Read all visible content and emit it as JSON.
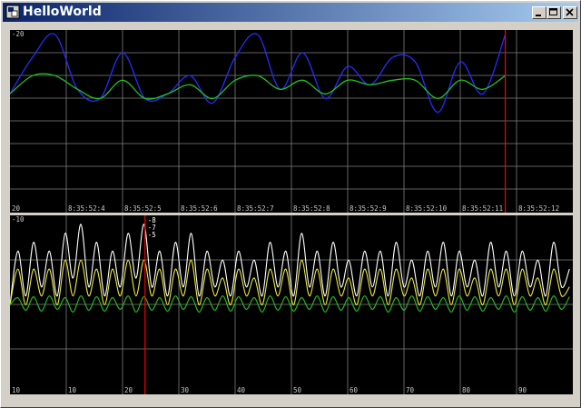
{
  "window": {
    "title": "HelloWorld"
  },
  "title_bar": {
    "minimize_icon": "minimize-icon",
    "maximize_icon": "maximize-icon",
    "close_icon": "close-icon"
  },
  "colors": {
    "background": "#000000",
    "grid": "#7f7f7f",
    "cursor": "#ff0000"
  },
  "chart_data": [
    {
      "type": "line",
      "y_top_label": "-20",
      "y_bottom_label": "20",
      "x_tick_labels": [
        "8:35:52:4",
        "8:35:52:5",
        "8:35:52:6",
        "8:35:52:7",
        "8:35:52:8",
        "8:35:52:9",
        "8:35:52:10",
        "8:35:52:11",
        "8:35:52:12"
      ],
      "ylim": [
        -20,
        20
      ],
      "cursor_x": 8.8,
      "series": [
        {
          "color": "#2a2aff",
          "x": [
            0,
            0.4,
            0.8,
            1.2,
            1.6,
            2,
            2.4,
            2.8,
            3.2,
            3.6,
            4,
            4.4,
            4.8,
            5.2,
            5.6,
            6,
            6.4,
            6.8,
            7.2,
            7.6,
            8,
            8.4,
            8.8
          ],
          "values": [
            -6,
            -14,
            -19,
            -7,
            -5,
            -15,
            -5,
            -6,
            -10,
            -4,
            -14,
            -19,
            -7,
            -15,
            -5,
            -12,
            -8,
            -14,
            -13,
            -2,
            -13,
            -6,
            -19
          ]
        },
        {
          "color": "#22c022",
          "x": [
            0,
            0.4,
            0.8,
            1.2,
            1.6,
            2,
            2.4,
            2.8,
            3.2,
            3.6,
            4,
            4.4,
            4.8,
            5.2,
            5.6,
            6,
            6.4,
            6.8,
            7.2,
            7.6,
            8,
            8.4,
            8.8
          ],
          "values": [
            -6,
            -10,
            -10,
            -7,
            -5,
            -9,
            -5,
            -6,
            -8,
            -5,
            -9,
            -10,
            -7,
            -9,
            -6,
            -9,
            -8,
            -9,
            -9,
            -5,
            -9,
            -7,
            -10
          ]
        }
      ]
    },
    {
      "type": "line",
      "y_top_label": "-10",
      "x_tick_labels": [
        "10",
        "10",
        "20",
        "30",
        "40",
        "50",
        "60",
        "70",
        "80",
        "90"
      ],
      "xlim": [
        0,
        100
      ],
      "ylim": [
        -10,
        10
      ],
      "cursor_x": 24,
      "legend": [
        "-8",
        "-7",
        "-5"
      ],
      "series": [
        {
          "color": "#ffffff",
          "x": [
            0,
            1.4,
            2.8,
            4.2,
            5.6,
            7,
            8.4,
            9.8,
            11.2,
            12.6,
            14,
            15.4,
            16.8,
            18.2,
            19.6,
            21,
            22.4,
            23.8,
            25.2,
            26.6,
            28,
            29.4,
            30.8,
            32.2,
            33.6,
            35,
            36.4,
            37.8,
            39.2,
            40.6,
            42,
            43.4,
            44.8,
            46.2,
            47.6,
            49,
            50.4,
            51.8,
            53.2,
            54.6,
            56,
            57.4,
            58.8,
            60.2,
            61.6,
            63,
            64.4,
            65.8,
            67.2,
            68.6,
            70,
            71.4,
            72.8,
            74.2,
            75.6,
            77,
            78.4,
            79.8,
            81.2,
            82.6,
            84,
            85.4,
            86.8,
            88.2,
            89.6,
            91,
            92.4,
            93.8,
            95.2,
            96.6,
            98,
            99.4
          ],
          "values": [
            0,
            6,
            1,
            7,
            2,
            6,
            1,
            8,
            3,
            9,
            2,
            7,
            1,
            6,
            2,
            8,
            3,
            9,
            2,
            6,
            1,
            7,
            2,
            8,
            1,
            6,
            2,
            5,
            1,
            6,
            2,
            5,
            1,
            7,
            2,
            6,
            1,
            8,
            2,
            6,
            1,
            7,
            2,
            5,
            1,
            6,
            2,
            6,
            1,
            7,
            2,
            5,
            1,
            6,
            2,
            7,
            1,
            6,
            2,
            5,
            1,
            7,
            2,
            6,
            1,
            6,
            2,
            5,
            1,
            7,
            2,
            4
          ]
        },
        {
          "color": "#e8e83c",
          "x": [
            0,
            1.4,
            2.8,
            4.2,
            5.6,
            7,
            8.4,
            9.8,
            11.2,
            12.6,
            14,
            15.4,
            16.8,
            18.2,
            19.6,
            21,
            22.4,
            23.8,
            25.2,
            26.6,
            28,
            29.4,
            30.8,
            32.2,
            33.6,
            35,
            36.4,
            37.8,
            39.2,
            40.6,
            42,
            43.4,
            44.8,
            46.2,
            47.6,
            49,
            50.4,
            51.8,
            53.2,
            54.6,
            56,
            57.4,
            58.8,
            60.2,
            61.6,
            63,
            64.4,
            65.8,
            67.2,
            68.6,
            70,
            71.4,
            72.8,
            74.2,
            75.6,
            77,
            78.4,
            79.8,
            81.2,
            82.6,
            84,
            85.4,
            86.8,
            88.2,
            89.6,
            91,
            92.4,
            93.8,
            95.2,
            96.6,
            98,
            99.4
          ],
          "values": [
            0,
            4,
            0,
            4,
            1,
            4,
            0,
            5,
            1,
            5,
            1,
            4,
            0,
            4,
            1,
            5,
            1,
            5,
            1,
            4,
            0,
            4,
            1,
            5,
            0,
            4,
            1,
            3,
            0,
            4,
            1,
            3,
            0,
            4,
            1,
            4,
            0,
            5,
            1,
            4,
            0,
            4,
            1,
            3,
            0,
            4,
            1,
            4,
            0,
            4,
            1,
            3,
            0,
            4,
            1,
            4,
            0,
            4,
            1,
            3,
            0,
            4,
            1,
            4,
            0,
            4,
            1,
            3,
            0,
            4,
            1,
            2
          ]
        },
        {
          "color": "#22c022",
          "x": [
            0,
            1.4,
            2.8,
            4.2,
            5.6,
            7,
            8.4,
            9.8,
            11.2,
            12.6,
            14,
            15.4,
            16.8,
            18.2,
            19.6,
            21,
            22.4,
            23.8,
            25.2,
            26.6,
            28,
            29.4,
            30.8,
            32.2,
            33.6,
            35,
            36.4,
            37.8,
            39.2,
            40.6,
            42,
            43.4,
            44.8,
            46.2,
            47.6,
            49,
            50.4,
            51.8,
            53.2,
            54.6,
            56,
            57.4,
            58.8,
            60.2,
            61.6,
            63,
            64.4,
            65.8,
            67.2,
            68.6,
            70,
            71.4,
            72.8,
            74.2,
            75.6,
            77,
            78.4,
            79.8,
            81.2,
            82.6,
            84,
            85.4,
            86.8,
            88.2,
            89.6,
            91,
            92.4,
            93.8,
            95.2,
            96.6,
            98,
            99.4
          ],
          "values": [
            0,
            0.8,
            -0.6,
            0.9,
            -0.7,
            1,
            -0.5,
            0.8,
            -0.8,
            1,
            -0.6,
            0.9,
            -0.7,
            0.8,
            -0.5,
            1,
            -0.8,
            0.9,
            -0.6,
            0.8,
            -0.7,
            1,
            -0.5,
            0.9,
            -0.8,
            0.8,
            -0.6,
            1,
            -0.7,
            0.9,
            -0.5,
            0.8,
            -0.8,
            1,
            -0.6,
            0.9,
            -0.7,
            0.8,
            -0.5,
            1,
            -0.8,
            0.9,
            -0.6,
            0.8,
            -0.7,
            1,
            -0.5,
            0.9,
            -0.8,
            0.8,
            -0.6,
            1,
            -0.7,
            0.9,
            -0.5,
            0.8,
            -0.8,
            1,
            -0.6,
            0.9,
            -0.7,
            0.8,
            -0.5,
            1,
            -0.8,
            0.9,
            -0.6,
            0.8,
            -0.7,
            1,
            -0.5,
            0.9
          ]
        }
      ]
    }
  ]
}
